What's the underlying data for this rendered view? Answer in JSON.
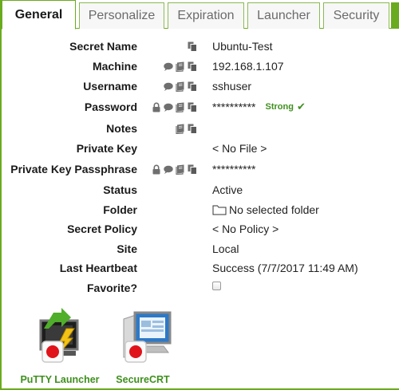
{
  "tabs": [
    {
      "label": "General",
      "active": true
    },
    {
      "label": "Personalize",
      "active": false
    },
    {
      "label": "Expiration",
      "active": false
    },
    {
      "label": "Launcher",
      "active": false
    },
    {
      "label": "Security",
      "active": false
    }
  ],
  "fields": {
    "secret_name": {
      "label": "Secret Name",
      "value": "Ubuntu-Test",
      "icons": [
        "copy-icon"
      ]
    },
    "machine": {
      "label": "Machine",
      "value": "192.168.1.107",
      "icons": [
        "comment-icon",
        "book-icon",
        "copy-icon"
      ]
    },
    "username": {
      "label": "Username",
      "value": "sshuser",
      "icons": [
        "comment-icon",
        "book-icon",
        "copy-icon"
      ]
    },
    "password": {
      "label": "Password",
      "value": "**********",
      "strength": "Strong",
      "icons": [
        "lock-icon",
        "comment-icon",
        "book-icon",
        "copy-icon"
      ]
    },
    "notes": {
      "label": "Notes",
      "value": "",
      "icons": [
        "book-icon",
        "copy-icon"
      ]
    },
    "private_key": {
      "label": "Private Key",
      "value": "< No File >"
    },
    "private_key_passphrase": {
      "label": "Private Key Passphrase",
      "value": "**********",
      "icons": [
        "lock-icon",
        "comment-icon",
        "book-icon",
        "copy-icon"
      ]
    },
    "status": {
      "label": "Status",
      "value": "Active"
    },
    "folder": {
      "label": "Folder",
      "value": "No selected folder"
    },
    "secret_policy": {
      "label": "Secret Policy",
      "value": "< No Policy >"
    },
    "site": {
      "label": "Site",
      "value": "Local"
    },
    "last_heartbeat": {
      "label": "Last Heartbeat",
      "value": "Success (7/7/2017 11:49 AM)"
    },
    "favorite": {
      "label": "Favorite?",
      "checked": false
    }
  },
  "launchers": [
    {
      "label": "PuTTY Launcher",
      "icon": "putty-icon"
    },
    {
      "label": "SecureCRT",
      "icon": "securecrt-icon"
    }
  ],
  "colors": {
    "accent": "#6aaa1e",
    "strength": "#3f8f1e"
  }
}
